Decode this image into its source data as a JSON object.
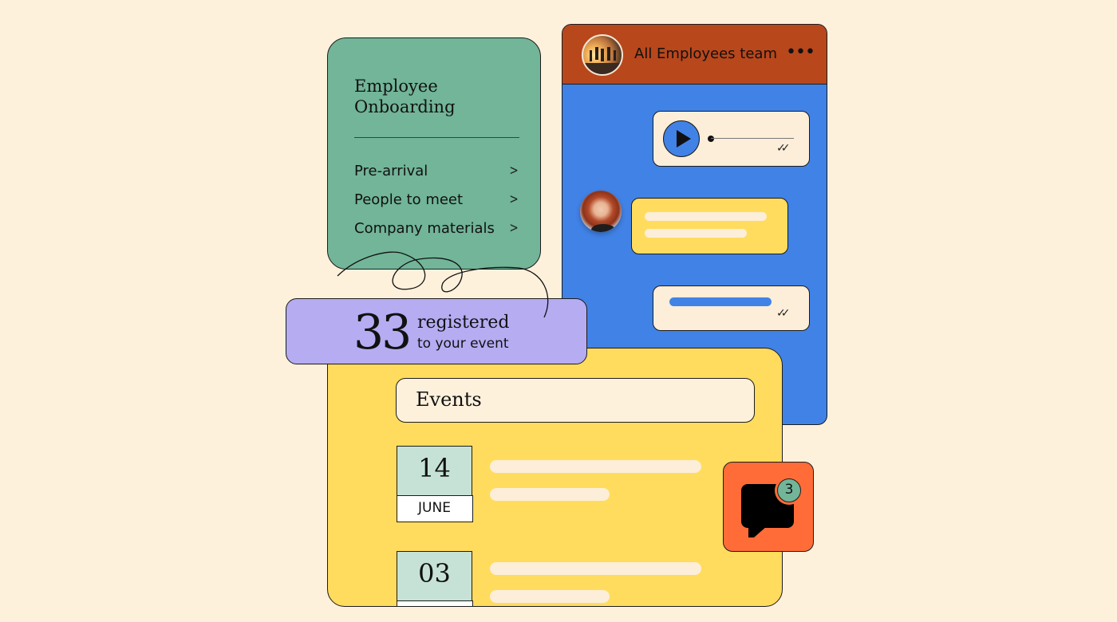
{
  "onboarding": {
    "title_line1": "Employee",
    "title_line2": "Onboarding",
    "items": [
      {
        "label": "Pre-arrival",
        "icon": "chevron-right-icon",
        "glyph": ">"
      },
      {
        "label": "People to meet",
        "icon": "chevron-right-icon",
        "glyph": ">"
      },
      {
        "label": "Company materials",
        "icon": "chevron-right-icon",
        "glyph": ">"
      }
    ]
  },
  "chat": {
    "team_name": "All Employees team",
    "more_glyph": "•••",
    "read_glyph": "✓✓",
    "colors": {
      "header": "#b8471c",
      "background": "#4182e6"
    }
  },
  "registered": {
    "count": "33",
    "label_line1": "registered",
    "label_line2": "to your event"
  },
  "events": {
    "title": "Events",
    "items": [
      {
        "day": "14",
        "month": "JUNE"
      },
      {
        "day": "03",
        "month": ""
      }
    ]
  },
  "notification": {
    "count": "3",
    "icon": "chat-bubble-icon"
  },
  "colors": {
    "page_bg": "#fef1dc",
    "green": "#72b599",
    "yellow": "#ffdc5e",
    "purple": "#b5acf2",
    "orange": "#ff6c38"
  }
}
